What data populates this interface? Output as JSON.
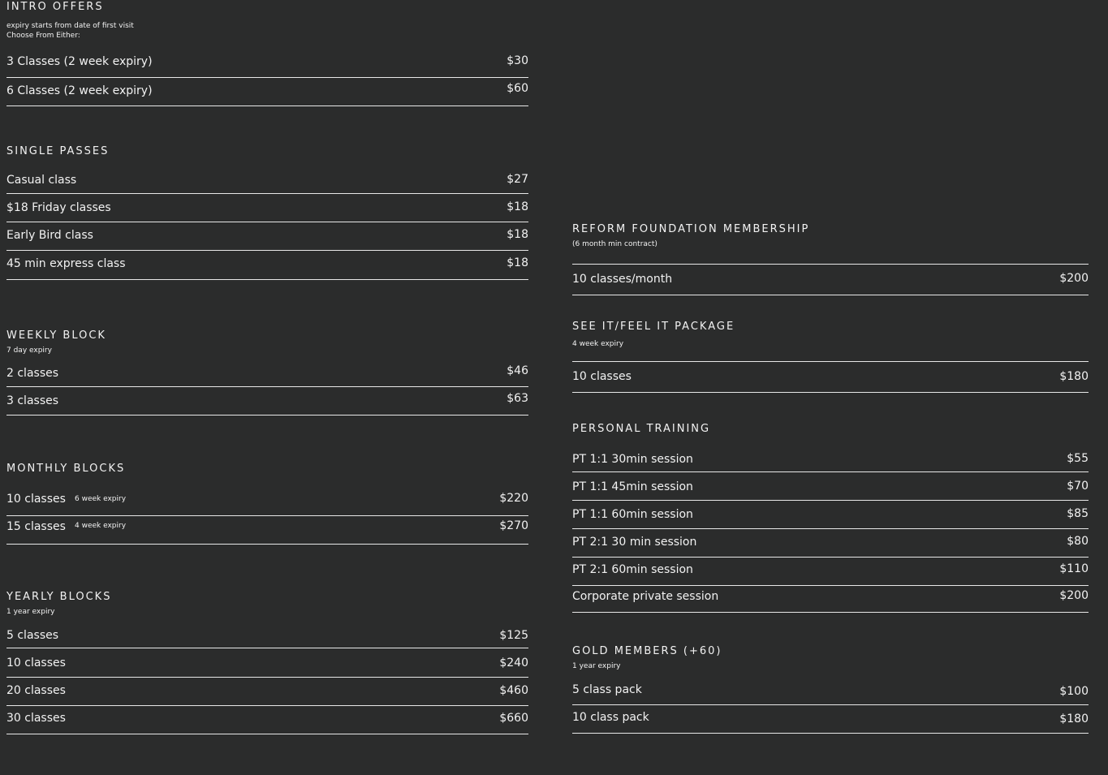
{
  "intro_offers": {
    "title": "INTRO OFFERS",
    "subtitle_1": "expiry starts from date of first visit",
    "subtitle_2": "Choose From Either:",
    "items": [
      {
        "label": "3 Classes (2 week expiry)",
        "price": "$30"
      },
      {
        "label": "6 Classes (2 week expiry)",
        "price": "$60"
      }
    ]
  },
  "single_passes": {
    "title": "SINGLE PASSES",
    "items": [
      {
        "label": "Casual class",
        "price": "$27"
      },
      {
        "label": "$18 Friday classes",
        "price": "$18"
      },
      {
        "label": "Early Bird class",
        "price": "$18"
      },
      {
        "label": "45 min express class",
        "price": "$18"
      }
    ]
  },
  "weekly_block": {
    "title": "WEEKLY BLOCK",
    "subtitle": "7 day expiry",
    "items": [
      {
        "label": "2 classes",
        "price": "$46"
      },
      {
        "label": "3 classes",
        "price": "$63"
      }
    ]
  },
  "monthly_blocks": {
    "title": "MONTHLY BLOCKS",
    "items": [
      {
        "label": "10 classes",
        "note": "6 week  expiry",
        "price": "$220"
      },
      {
        "label": "15 classes",
        "note": "4 week  expiry",
        "price": "$270"
      }
    ]
  },
  "yearly_blocks": {
    "title": "YEARLY BLOCKS",
    "subtitle": "1 year expiry",
    "items": [
      {
        "label": "5 classes",
        "price": "$125"
      },
      {
        "label": "10 classes",
        "price": "$240"
      },
      {
        "label": "20 classes",
        "price": "$460"
      },
      {
        "label": "30 classes",
        "price": "$660"
      }
    ]
  },
  "reform_foundation": {
    "title": "REFORM FOUNDATION MEMBERSHIP",
    "subtitle": "(6 month min contract)",
    "items": [
      {
        "label": "10 classes/month",
        "price": "$200"
      }
    ]
  },
  "see_it_feel_it": {
    "title": "SEE IT/FEEL IT PACKAGE",
    "subtitle": "4 week expiry",
    "items": [
      {
        "label": "10 classes",
        "price": "$180"
      }
    ]
  },
  "personal_training": {
    "title": "PERSONAL TRAINING",
    "items": [
      {
        "label": "PT 1:1 30min session",
        "price": "$55"
      },
      {
        "label": "PT 1:1 45min session",
        "price": "$70"
      },
      {
        "label": "PT 1:1 60min session",
        "price": "$85"
      },
      {
        "label": "PT 2:1 30 min session",
        "price": "$80"
      },
      {
        "label": "PT 2:1 60min session",
        "price": "$110"
      },
      {
        "label": "Corporate private session",
        "price": "$200"
      }
    ]
  },
  "gold_members": {
    "title": "GOLD MEMBERS (+60)",
    "subtitle": "1 year expiry",
    "items": [
      {
        "label": "5 class pack",
        "price": "$100"
      },
      {
        "label": "10 class pack",
        "price": "$180"
      }
    ]
  }
}
